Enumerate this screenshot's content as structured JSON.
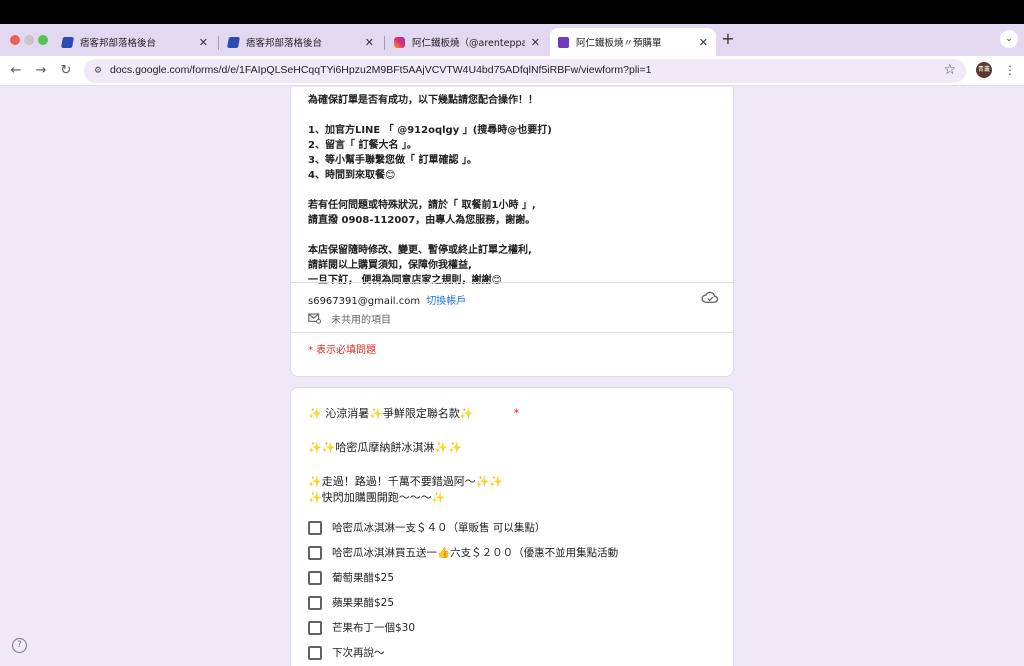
{
  "browser": {
    "tabs": [
      {
        "title": "痞客邦部落格後台"
      },
      {
        "title": "痞客邦部落格後台"
      },
      {
        "title": "阿仁鐵板燒（@arenteppanyaki"
      },
      {
        "title": "阿仁鐵板燒〃預購單"
      }
    ],
    "new_tab": "+",
    "tab_menu": "⌄",
    "url": "docs.google.com/forms/d/e/1FAIpQLSeHCqqTYi6Hpzu2M9BFt5AAjVCVTW4U4bd75ADfqlNf5iRBFw/viewform?pli=1",
    "avatar_label": "青叢"
  },
  "form": {
    "description": [
      "為確保訂單是否有成功，以下幾點請您配合操作！！",
      "",
      "1、加官方LINE 「 @912oqlgy 」(搜尋時@也要打)",
      "2、留言「 訂餐大名 」。",
      "3、等小幫手聯繫您做「 訂單確認 」。",
      "4、時間到來取餐😊",
      "",
      "若有任何問題或特殊狀況，請於「 取餐前1小時 」,",
      "請直撥 0908-112007，由專人為您服務，謝謝。",
      "",
      "本店保留隨時修改、變更、暫停或終止訂單之權利,",
      "請詳閱以上購買須知，保障你我權益,",
      "一旦下訂， 便視為同意店家之規則，謝謝😊"
    ],
    "account_email": "s6967391@gmail.com",
    "switch_account": "切換帳戶",
    "unshared_label": "未共用的項目",
    "required_note": "* 表示必填問題",
    "question": {
      "title": "✨ 沁涼消暑✨爭鮮限定聯名款✨",
      "required_mark": "*",
      "subtitle": "✨✨哈密瓜摩納餅冰淇淋✨✨",
      "line1": "✨走過！路過！千萬不要錯過阿～✨✨",
      "line2": "✨快閃加購團開跑～～～✨",
      "options": [
        "哈密瓜冰淇淋一支＄４０（單販售 可以集點）",
        "哈密瓜冰淇淋買五送一👍六支＄２００（優惠不並用集點活動",
        "葡萄果醋$25",
        "蘋果果醋$25",
        "芒果布丁一個$30",
        "下次再說～"
      ]
    }
  },
  "help_label": "?"
}
